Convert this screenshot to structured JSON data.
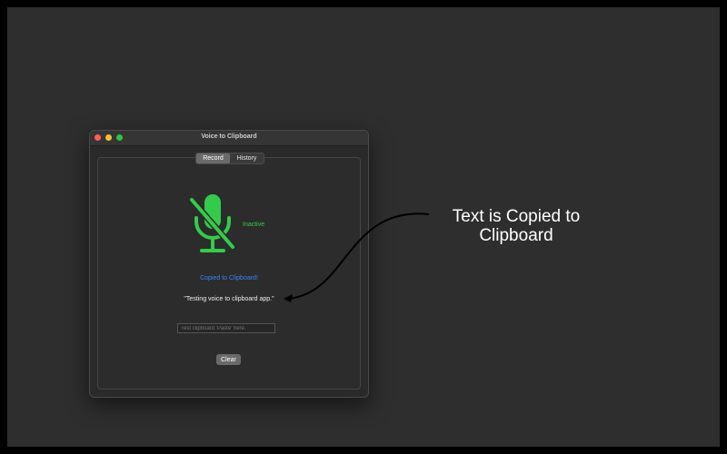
{
  "window": {
    "title": "Voice to Clipboard"
  },
  "tabs": [
    {
      "label": "Record",
      "active": true
    },
    {
      "label": "History",
      "active": false
    }
  ],
  "recorder": {
    "icon": "microphone-slash-icon",
    "status": "Inactive",
    "status_color": "#33cc4a"
  },
  "copied_message": "Copied to Clipboard!",
  "copied_color": "#3b82f6",
  "transcript": "\"Testing voice to clipboard app.\"",
  "test_field": {
    "value": "",
    "placeholder": "Test clipboard 'Paste' here."
  },
  "clear_label": "Clear",
  "annotation": {
    "text": "Text is Copied to Clipboard"
  }
}
